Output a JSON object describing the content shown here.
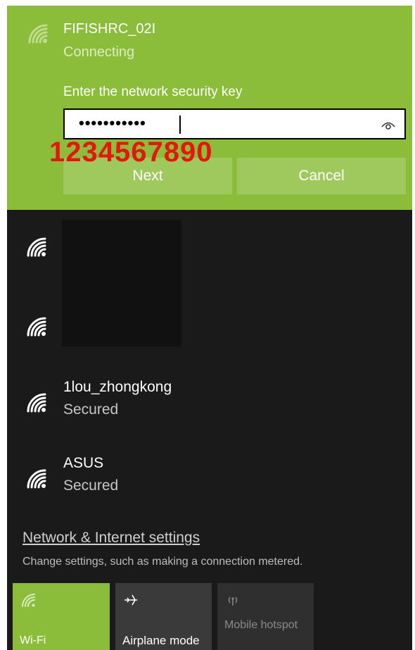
{
  "connecting": {
    "network_name": "FIFISHRC_02I",
    "status": "Connecting",
    "key_label": "Enter the network security key",
    "key_masked": "•••••••••••",
    "next_label": "Next",
    "cancel_label": "Cancel",
    "annotation": "1234567890"
  },
  "networks": [
    {
      "name": "",
      "status": ""
    },
    {
      "name": "",
      "status": ""
    },
    {
      "name": "1lou_zhongkong",
      "status": "Secured"
    },
    {
      "name": "ASUS",
      "status": "Secured"
    }
  ],
  "settings": {
    "link_label": "Network & Internet settings",
    "description": "Change settings, such as making a connection metered."
  },
  "quick_actions": [
    {
      "label": "Wi-Fi",
      "icon": "wifi-icon",
      "active": true
    },
    {
      "label": "Airplane mode",
      "icon": "airplane-icon",
      "active": false
    },
    {
      "label": "Mobile hotspot",
      "icon": "hotspot-icon",
      "active": false
    }
  ],
  "colors": {
    "accent": "#8cbd3a",
    "panel_bg": "#1a1a1a",
    "annotation": "#e8140f"
  }
}
